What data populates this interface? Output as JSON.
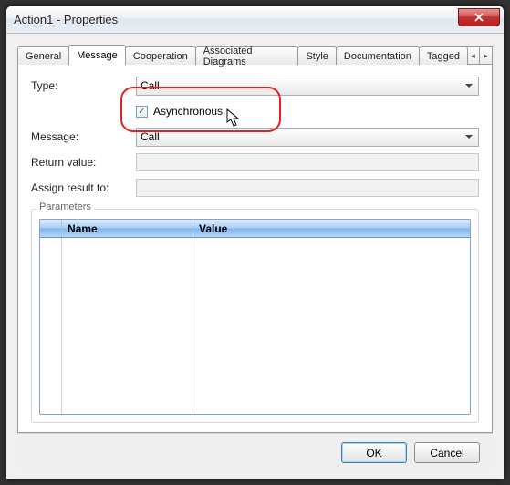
{
  "window": {
    "title": "Action1 - Properties"
  },
  "tabs": {
    "items": [
      "General",
      "Message",
      "Cooperation",
      "Associated Diagrams",
      "Style",
      "Documentation",
      "Tagged"
    ],
    "active_index": 1,
    "scroll_left": "◂",
    "scroll_right": "▸"
  },
  "form": {
    "type_label": "Type:",
    "type_value": "Call",
    "async_label": "Asynchronous",
    "async_checked": true,
    "message_label": "Message:",
    "message_value": "Call",
    "return_label": "Return value:",
    "return_value": "",
    "assign_label": "Assign result to:",
    "assign_value": ""
  },
  "parameters": {
    "group_label": "Parameters",
    "columns": {
      "name": "Name",
      "value": "Value"
    },
    "rows": []
  },
  "buttons": {
    "ok": "OK",
    "cancel": "Cancel"
  },
  "checkmark_glyph": "✓"
}
